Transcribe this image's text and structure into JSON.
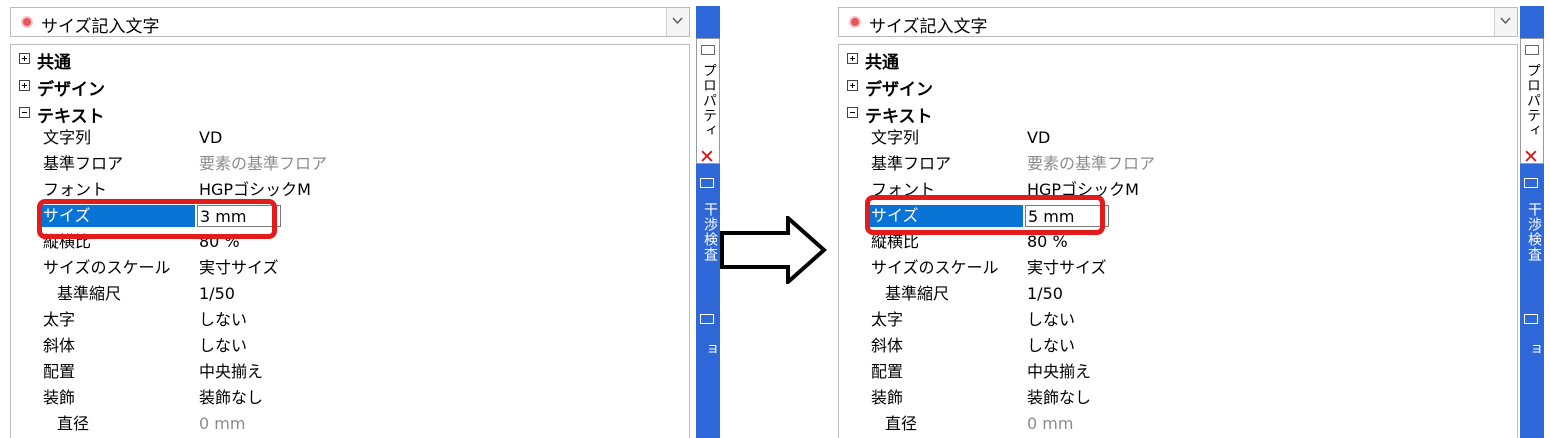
{
  "left_panel": {
    "selector": "サイズ記入文字",
    "categories": [
      "共通",
      "デザイン",
      "テキスト"
    ],
    "rows": [
      {
        "key": "文字列",
        "value": "VD"
      },
      {
        "key": "基準フロア",
        "value": "要素の基準フロア"
      },
      {
        "key": "フォント",
        "value": "HGPゴシックM"
      },
      {
        "key": "サイズ",
        "value": "3 mm"
      },
      {
        "key": "縦横比",
        "value": "80 %"
      },
      {
        "key": "サイズのスケール",
        "value": "実寸サイズ"
      },
      {
        "key": "基準縮尺",
        "value": "1/50"
      },
      {
        "key": "太字",
        "value": "しない"
      },
      {
        "key": "斜体",
        "value": "しない"
      },
      {
        "key": "配置",
        "value": "中央揃え"
      },
      {
        "key": "装飾",
        "value": "装飾なし"
      },
      {
        "key": "直径",
        "value": "0 mm"
      }
    ],
    "sidebar_tabs": [
      "プロパティ",
      "干渉検査",
      "シミュレーショ"
    ]
  },
  "right_panel": {
    "selector": "サイズ記入文字",
    "categories": [
      "共通",
      "デザイン",
      "テキスト"
    ],
    "rows": [
      {
        "key": "文字列",
        "value": "VD"
      },
      {
        "key": "基準フロア",
        "value": "要素の基準フロア"
      },
      {
        "key": "フォント",
        "value": "HGPゴシックM"
      },
      {
        "key": "サイズ",
        "value": "5 mm"
      },
      {
        "key": "縦横比",
        "value": "80 %"
      },
      {
        "key": "サイズのスケール",
        "value": "実寸サイズ"
      },
      {
        "key": "基準縮尺",
        "value": "1/50"
      },
      {
        "key": "太字",
        "value": "しない"
      },
      {
        "key": "斜体",
        "value": "しない"
      },
      {
        "key": "配置",
        "value": "中央揃え"
      },
      {
        "key": "装飾",
        "value": "装飾なし"
      },
      {
        "key": "直径",
        "value": "0 mm"
      }
    ],
    "sidebar_tabs": [
      "プロパティ",
      "干渉検査",
      "シミュレーショ"
    ]
  },
  "colors": {
    "selection": "#0a74d6",
    "highlight": "#e41b1b",
    "sidebar": "#2d67d8"
  },
  "icons": [
    "selector-dot-icon",
    "dropdown-chevron-icon",
    "expand-plus-icon",
    "collapse-minus-icon",
    "close-x-icon",
    "right-arrow-icon"
  ]
}
